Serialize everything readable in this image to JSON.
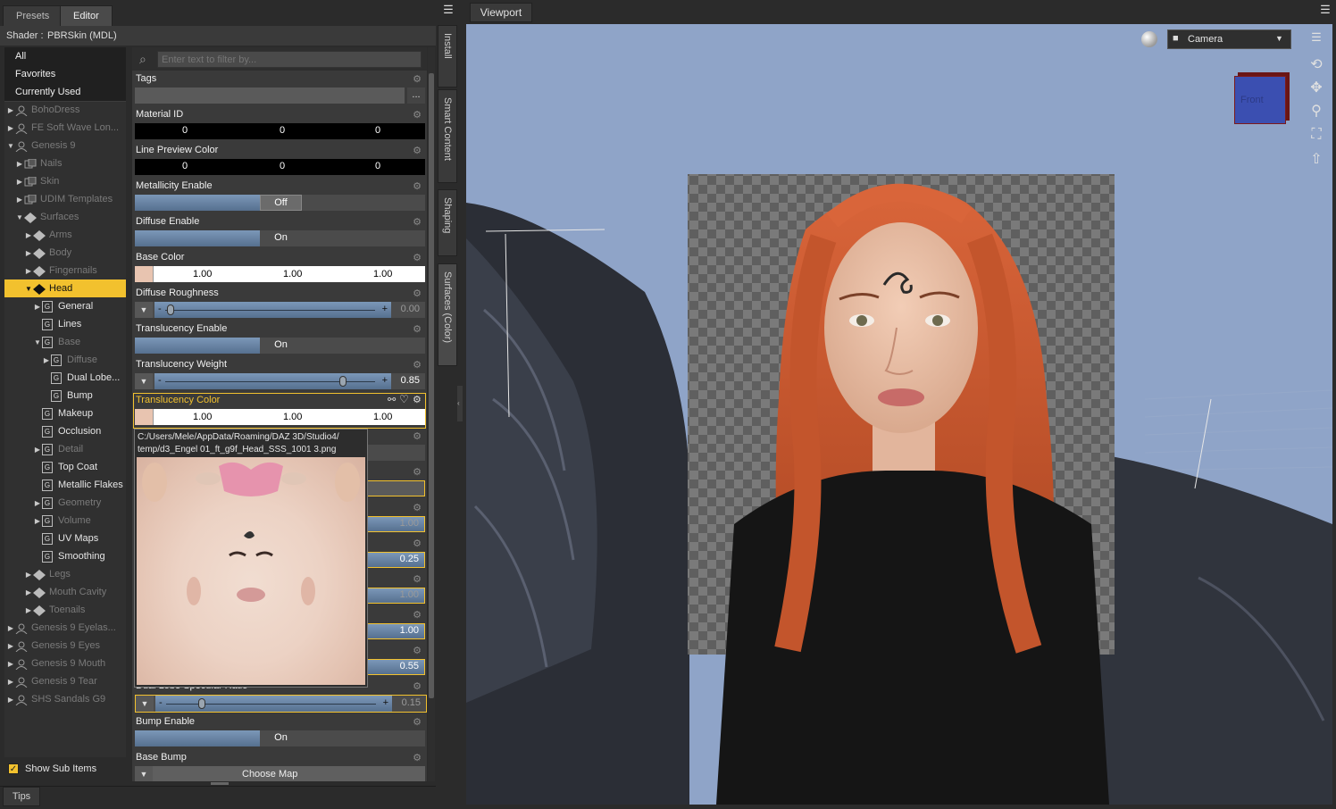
{
  "left_pane": {
    "tabs": [
      {
        "label": "Presets",
        "active": false
      },
      {
        "label": "Editor",
        "active": true
      }
    ],
    "shader_label": "Shader :",
    "shader_value": "PBRSkin (MDL)",
    "filter_placeholder": "Enter text to filter by...",
    "tree_fixed": [
      "All",
      "Favorites",
      "Currently Used"
    ],
    "tree": [
      {
        "label": "BohoDress",
        "depth": 0,
        "arrow": "right",
        "icon": "figure",
        "dim": true
      },
      {
        "label": "FE Soft Wave Lon...",
        "depth": 0,
        "arrow": "right",
        "icon": "figure",
        "dim": true
      },
      {
        "label": "Genesis 9",
        "depth": 0,
        "arrow": "down",
        "icon": "figure",
        "dim": true
      },
      {
        "label": "Nails",
        "depth": 1,
        "arrow": "right",
        "icon": "group",
        "dim": true
      },
      {
        "label": "Skin",
        "depth": 1,
        "arrow": "right",
        "icon": "group",
        "dim": true
      },
      {
        "label": "UDIM Templates",
        "depth": 1,
        "arrow": "right",
        "icon": "group",
        "dim": true
      },
      {
        "label": "Surfaces",
        "depth": 1,
        "arrow": "down",
        "icon": "surface",
        "dim": true
      },
      {
        "label": "Arms",
        "depth": 2,
        "arrow": "right",
        "icon": "surface",
        "dim": true
      },
      {
        "label": "Body",
        "depth": 2,
        "arrow": "right",
        "icon": "surface",
        "dim": true
      },
      {
        "label": "Fingernails",
        "depth": 2,
        "arrow": "right",
        "icon": "surface",
        "dim": true
      },
      {
        "label": "Head",
        "depth": 2,
        "arrow": "down",
        "icon": "surface",
        "dim": false,
        "selected": true
      },
      {
        "label": "General",
        "depth": 3,
        "arrow": "right",
        "icon": "g",
        "dim": false
      },
      {
        "label": "Lines",
        "depth": 3,
        "arrow": "",
        "icon": "g",
        "dim": false
      },
      {
        "label": "Base",
        "depth": 3,
        "arrow": "down",
        "icon": "g",
        "dim": true
      },
      {
        "label": "Diffuse",
        "depth": 4,
        "arrow": "right",
        "icon": "g",
        "dim": true
      },
      {
        "label": "Dual Lobe...",
        "depth": 4,
        "arrow": "",
        "icon": "g",
        "dim": false
      },
      {
        "label": "Bump",
        "depth": 4,
        "arrow": "",
        "icon": "g",
        "dim": false
      },
      {
        "label": "Makeup",
        "depth": 3,
        "arrow": "",
        "icon": "g",
        "dim": false
      },
      {
        "label": "Occlusion",
        "depth": 3,
        "arrow": "",
        "icon": "g",
        "dim": false
      },
      {
        "label": "Detail",
        "depth": 3,
        "arrow": "right",
        "icon": "g",
        "dim": true
      },
      {
        "label": "Top Coat",
        "depth": 3,
        "arrow": "",
        "icon": "g",
        "dim": false
      },
      {
        "label": "Metallic Flakes",
        "depth": 3,
        "arrow": "",
        "icon": "g",
        "dim": false
      },
      {
        "label": "Geometry",
        "depth": 3,
        "arrow": "right",
        "icon": "g",
        "dim": true
      },
      {
        "label": "Volume",
        "depth": 3,
        "arrow": "right",
        "icon": "g",
        "dim": true
      },
      {
        "label": "UV Maps",
        "depth": 3,
        "arrow": "",
        "icon": "g",
        "dim": false
      },
      {
        "label": "Smoothing",
        "depth": 3,
        "arrow": "",
        "icon": "g",
        "dim": false
      },
      {
        "label": "Legs",
        "depth": 2,
        "arrow": "right",
        "icon": "surface",
        "dim": true
      },
      {
        "label": "Mouth Cavity",
        "depth": 2,
        "arrow": "right",
        "icon": "surface",
        "dim": true
      },
      {
        "label": "Toenails",
        "depth": 2,
        "arrow": "right",
        "icon": "surface",
        "dim": true
      },
      {
        "label": "Genesis 9 Eyelas...",
        "depth": 0,
        "arrow": "right",
        "icon": "figure",
        "dim": true
      },
      {
        "label": "Genesis 9 Eyes",
        "depth": 0,
        "arrow": "right",
        "icon": "figure",
        "dim": true
      },
      {
        "label": "Genesis 9 Mouth",
        "depth": 0,
        "arrow": "right",
        "icon": "figure",
        "dim": true
      },
      {
        "label": "Genesis 9 Tear",
        "depth": 0,
        "arrow": "right",
        "icon": "figure",
        "dim": true
      },
      {
        "label": "SHS Sandals G9",
        "depth": 0,
        "arrow": "right",
        "icon": "figure",
        "dim": true
      }
    ],
    "show_sub_items_label": "Show Sub Items",
    "show_sub_items_checked": true,
    "tips_label": "Tips"
  },
  "properties": {
    "tags_label": "Tags",
    "tags_button": "...",
    "material_id": {
      "label": "Material ID",
      "values": [
        "0",
        "0",
        "0"
      ]
    },
    "line_preview_color": {
      "label": "Line Preview Color",
      "values": [
        "0",
        "0",
        "0"
      ]
    },
    "metallicity_enable": {
      "label": "Metallicity Enable",
      "value": "Off"
    },
    "diffuse_enable": {
      "label": "Diffuse Enable",
      "value": "On"
    },
    "base_color": {
      "label": "Base Color",
      "values": [
        "1.00",
        "1.00",
        "1.00"
      ]
    },
    "diffuse_roughness": {
      "label": "Diffuse Roughness",
      "value": "0.00",
      "fraction": 0.0
    },
    "translucency_enable": {
      "label": "Translucency Enable",
      "value": "On"
    },
    "translucency_weight": {
      "label": "Translucency Weight",
      "value": "0.85",
      "fraction": 0.85
    },
    "translucency_color": {
      "label": "Translucency Color",
      "values": [
        "1.00",
        "1.00",
        "1.00"
      ]
    },
    "hidden_values": [
      "1.00",
      "0.25",
      "1.00",
      "1.00",
      "0.55"
    ],
    "dual_lobe_label": "Dual Lobe Specular Ratio",
    "dual_lobe_value": "0.15",
    "dual_lobe_fraction": 0.15,
    "bump_enable": {
      "label": "Bump Enable",
      "value": "On"
    },
    "base_bump": {
      "label": "Base Bump",
      "value": "Choose Map"
    }
  },
  "tooltip": {
    "path_line1": "C:/Users/Mele/AppData/Roaming/DAZ 3D/Studio4/",
    "path_line2": "temp/d3_Engel 01_ft_g9f_Head_SSS_1001 3.png"
  },
  "side_tabs": [
    "Install",
    "Smart Content",
    "Shaping",
    "Surfaces (Color)"
  ],
  "viewport": {
    "tab_label": "Viewport",
    "camera_label": "Camera",
    "cube_label": "Front"
  },
  "colors": {
    "selection": "#f2c12e",
    "viewport_bg": "#8fa4c8",
    "hair": "#c0552e",
    "accent_blue": "#6f8bb0"
  }
}
